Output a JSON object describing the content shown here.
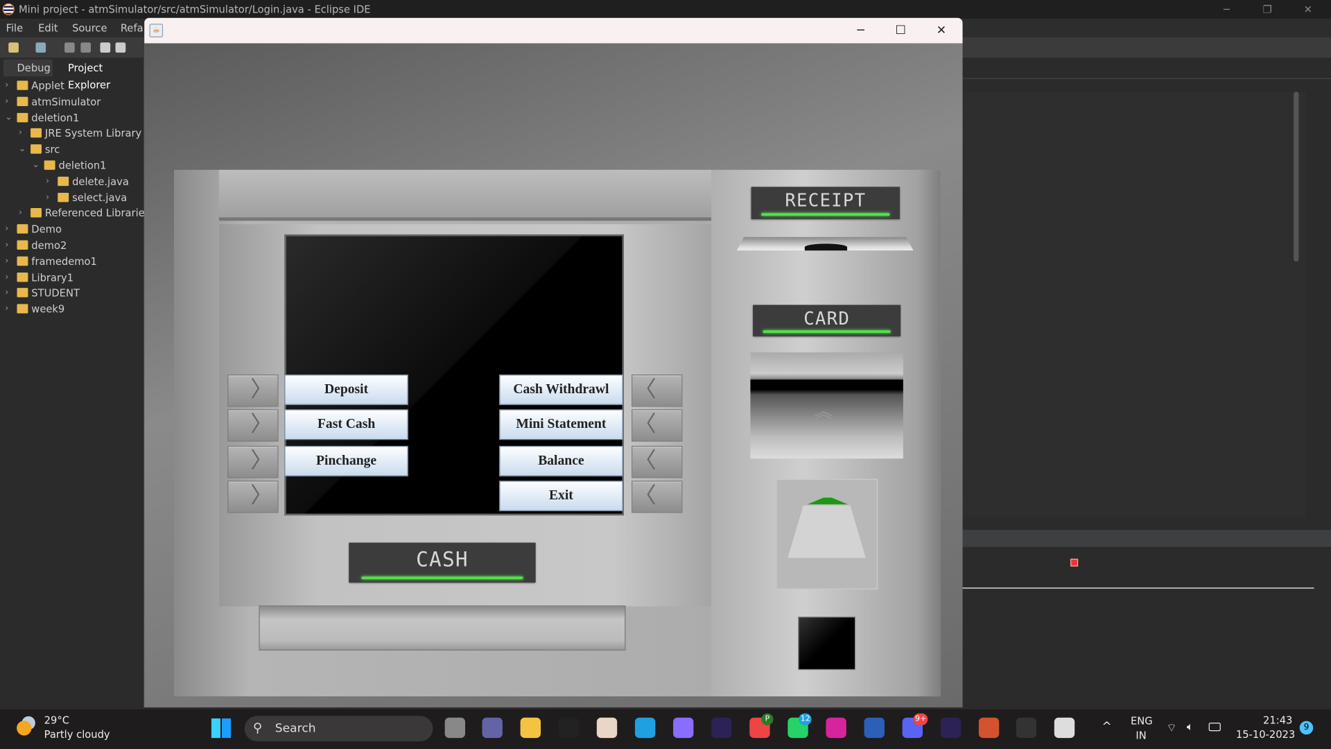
{
  "ide": {
    "title": "Mini project - atmSimulator/src/atmSimulator/Login.java - Eclipse IDE",
    "menu": [
      "File",
      "Edit",
      "Source",
      "Refa"
    ],
    "tabs": {
      "debug": "Debug",
      "explorer": "Project Explorer"
    },
    "tree": [
      {
        "label": "Applet",
        "level": 0,
        "expanded": false
      },
      {
        "label": "atmSimulator",
        "level": 0,
        "expanded": false
      },
      {
        "label": "deletion1",
        "level": 0,
        "expanded": true
      },
      {
        "label": "JRE System Library [jd",
        "level": 1,
        "expanded": false
      },
      {
        "label": "src",
        "level": 1,
        "expanded": true
      },
      {
        "label": "deletion1",
        "level": 2,
        "expanded": true
      },
      {
        "label": "delete.java",
        "level": 3,
        "expanded": false
      },
      {
        "label": "select.java",
        "level": 3,
        "expanded": false
      },
      {
        "label": "Referenced Libraries",
        "level": 1,
        "expanded": false
      },
      {
        "label": "Demo",
        "level": 0,
        "expanded": false
      },
      {
        "label": "demo2",
        "level": 0,
        "expanded": false
      },
      {
        "label": "framedemo1",
        "level": 0,
        "expanded": false
      },
      {
        "label": "Library1",
        "level": 0,
        "expanded": false
      },
      {
        "label": "STUDENT",
        "level": 0,
        "expanded": false
      },
      {
        "label": "week9",
        "level": 0,
        "expanded": false
      }
    ]
  },
  "window": {
    "minimize": "─",
    "maximize": "☐",
    "close": "✕"
  },
  "atm": {
    "receipt_label": "RECEIPT",
    "card_label": "CARD",
    "cash_label": "CASH",
    "buttons_left": [
      "Deposit",
      "Fast Cash",
      "Pinchange"
    ],
    "buttons_right": [
      "Cash Withdrawl",
      "Mini Statement",
      "Balance",
      "Exit"
    ],
    "indicator_color": "#56e04a"
  },
  "taskbar": {
    "weather_temp": "29°C",
    "weather_desc": "Partly cloudy",
    "search": "Search",
    "lang": "ENG",
    "region": "IN",
    "time": "21:43",
    "date": "15-10-2023",
    "notifications": "9",
    "badges": {
      "chrome": "P",
      "whatsapp": "12",
      "discord": "9+"
    }
  }
}
